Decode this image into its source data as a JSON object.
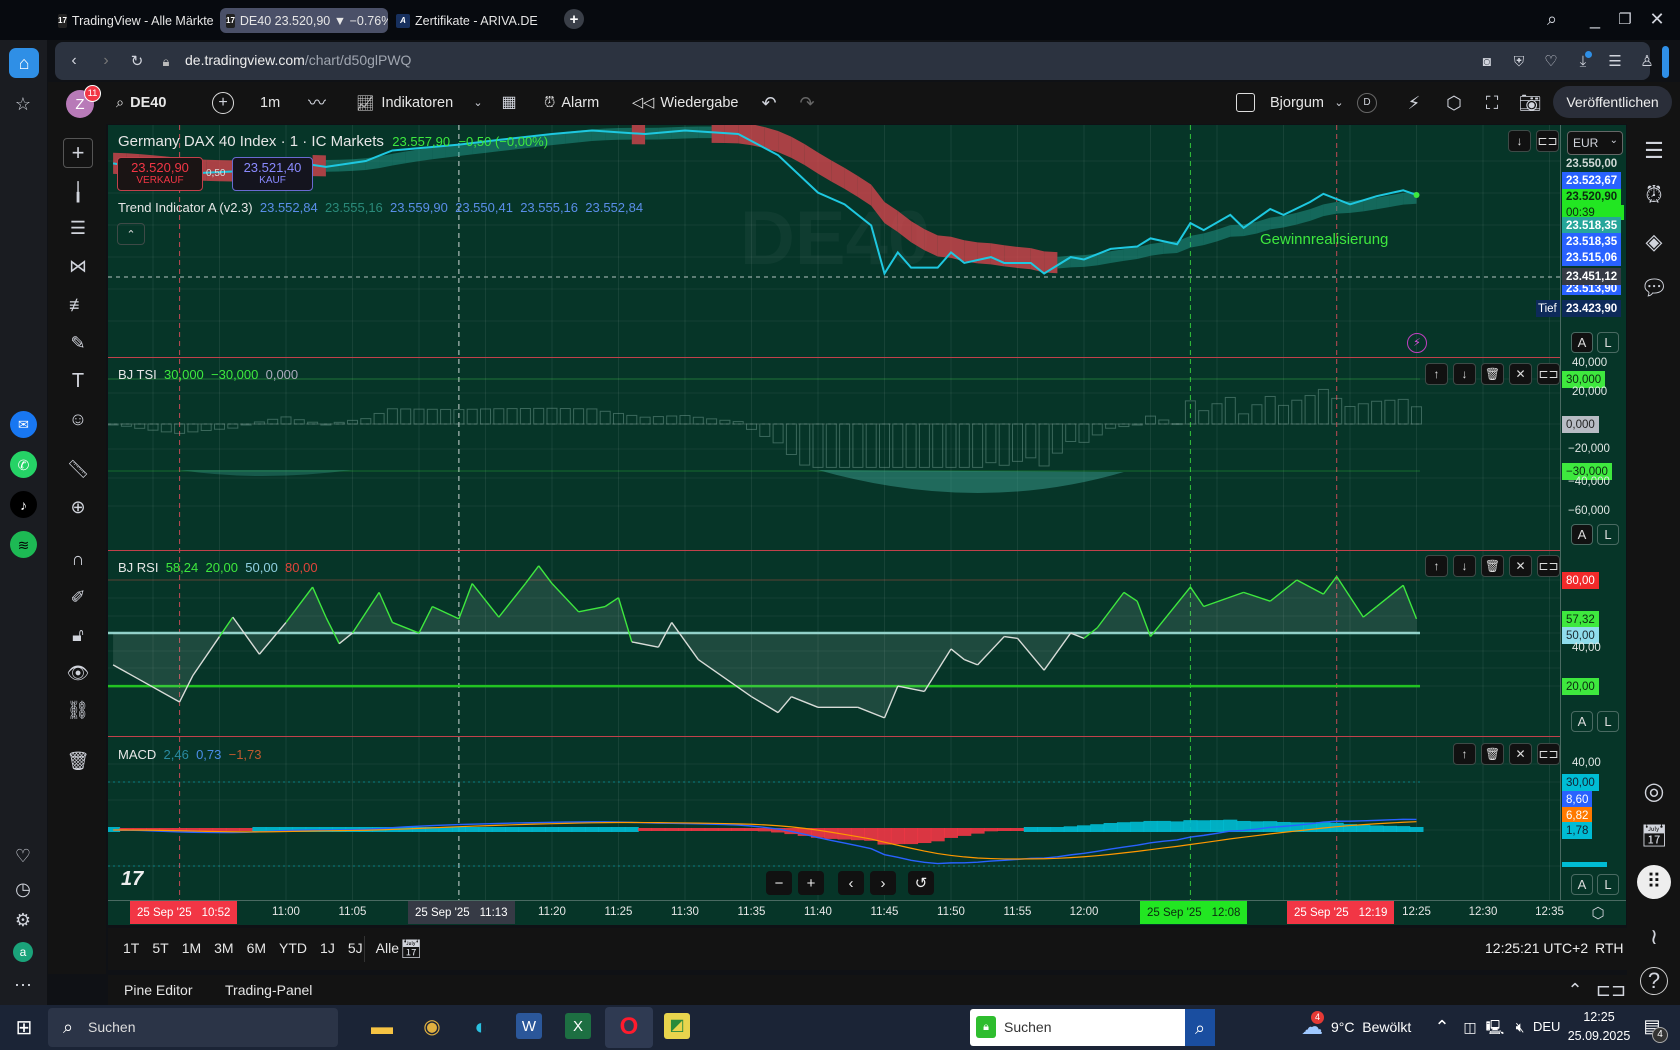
{
  "browser": {
    "tabs": [
      {
        "label": "TradingView - Alle Märkte"
      },
      {
        "label": "DE40 23.520,90 ▼ −0.76%"
      },
      {
        "label": "Zertifikate - ARIVA.DE"
      }
    ],
    "new_tab": "+",
    "url_domain": "de.tradingview.com",
    "url_path": "/chart/d50glPWQ"
  },
  "toolbar": {
    "avatar": "Z",
    "avatar_badge": "11",
    "symbol": "DE40",
    "interval": "1m",
    "indicators": "Indikatoren",
    "alarm": "Alarm",
    "replay": "Wiedergabe",
    "layout": "Bjorgum",
    "d_badge": "D",
    "publish": "Veröffentlichen"
  },
  "main": {
    "title": "Germany DAX 40 Index · 1 · IC Markets",
    "last": "23.557,90",
    "change": "−0,50 (−0,00%)",
    "sell_price": "23.520,90",
    "sell_label": "VERKAUF",
    "spread": "0,50",
    "buy_price": "23.521,40",
    "buy_label": "KAUF",
    "indicator_name": "Trend Indicator A (v2.3)",
    "indicator_values": [
      "23.552,84",
      "23.555,16",
      "23.559,90",
      "23.550,41",
      "23.555,16",
      "23.552,84"
    ],
    "watermark": "DE40",
    "annotation": "Gewinnrealisierung",
    "currency": "EUR",
    "price_labels": [
      {
        "text": "23.550,00",
        "bg": "#063528",
        "fg": "#e0e6e4"
      },
      {
        "text": "23.523,67",
        "bg": "#2962ff",
        "fg": "#ffffff"
      },
      {
        "text": "23.520,90",
        "bg": "#22e622",
        "fg": "#0b2a10"
      },
      {
        "text": "00:39",
        "bg": "#22e622",
        "fg": "#0b2a10"
      },
      {
        "text": "23.518,35",
        "bg": "#26a69a",
        "fg": "#ffffff"
      },
      {
        "text": "23.518,35",
        "bg": "#2962ff",
        "fg": "#ffffff"
      },
      {
        "text": "23.515,06",
        "bg": "#2962ff",
        "fg": "#ffffff"
      },
      {
        "text": "23.451,12",
        "bg": "#363a45",
        "fg": "#ffffff"
      },
      {
        "text": "23.513,90",
        "bg": "#2962ff",
        "fg": "#ffffff"
      }
    ],
    "low_label": "Tief",
    "low_value": "23.423,90"
  },
  "scale_buttons": {
    "auto": "A",
    "log": "L"
  },
  "tsi": {
    "name": "BJ TSI",
    "values": [
      "30,000",
      "−30,000",
      "0,000"
    ],
    "axis": [
      "40,000",
      "30,000",
      "20,000",
      "0,000",
      "−20,000",
      "−30,000",
      "−40,000",
      "−60,000"
    ]
  },
  "rsi": {
    "name": "BJ RSI",
    "values": [
      "58,24",
      "20,00",
      "50,00",
      "80,00"
    ],
    "axis": [
      "80,00",
      "57,32",
      "50,00",
      "40,00",
      "20,00"
    ]
  },
  "macd": {
    "name": "MACD",
    "values": [
      "2,46",
      "0,73",
      "−1,73"
    ],
    "axis": [
      "40,00",
      "30,00",
      "8,60",
      "6,82",
      "1,78"
    ]
  },
  "time_axis": {
    "labels": [
      "11:00",
      "11:05",
      "11:20",
      "11:25",
      "11:30",
      "11:35",
      "11:40",
      "11:45",
      "11:50",
      "11:55",
      "12:00",
      "12:25",
      "12:30",
      "12:35"
    ],
    "markers": [
      {
        "date": "25 Sep '25",
        "time": "10:52",
        "bg": "#f23645"
      },
      {
        "date": "25 Sep '25",
        "time": "11:13",
        "bg": "#363a45"
      },
      {
        "date": "25 Sep '25",
        "time": "12:08",
        "bg": "#22e622"
      },
      {
        "date": "25 Sep '25",
        "time": "12:19",
        "bg": "#f23645"
      }
    ]
  },
  "range_bar": {
    "items": [
      "1T",
      "5T",
      "1M",
      "3M",
      "6M",
      "YTD",
      "1J",
      "5J",
      "Alle"
    ],
    "clock": "12:25:21 UTC+2",
    "session": "RTH"
  },
  "bottom_panel": {
    "tabs": [
      "Pine Editor",
      "Trading-Panel"
    ]
  },
  "taskbar": {
    "search": "Suchen",
    "search2": "Suchen",
    "weather_badge": "4",
    "temp": "9°C",
    "weather": "Bewölkt",
    "lang": "DEU",
    "time": "12:25",
    "date": "25.09.2025",
    "notifications": "4"
  },
  "colors": {
    "chart_bg": "#063528",
    "price_line": "#1ec8e0",
    "trend_up": "#26a69a",
    "trend_down": "#e0454f",
    "rsi_up": "#3ee83e",
    "rsi_down": "#d8dcd8",
    "macd": "#2962ff",
    "signal": "#ff9800",
    "hist_pos": "#00bcd4",
    "hist_neg": "#f23645"
  },
  "chart_series": {
    "price": [
      [
        "10:47",
        23548
      ],
      [
        "10:52",
        23539
      ],
      [
        "10:56",
        23541
      ],
      [
        "11:00",
        23550
      ],
      [
        "11:03",
        23545
      ],
      [
        "11:06",
        23550
      ],
      [
        "11:08",
        23559
      ],
      [
        "11:13",
        23564
      ],
      [
        "11:16",
        23568
      ],
      [
        "11:20",
        23573
      ],
      [
        "11:23",
        23576
      ],
      [
        "11:27",
        23573
      ],
      [
        "11:30",
        23576
      ],
      [
        "11:34",
        23573
      ],
      [
        "11:37",
        23555
      ],
      [
        "11:40",
        23523
      ],
      [
        "11:42",
        23513
      ],
      [
        "11:44",
        23495
      ],
      [
        "11:45",
        23454
      ],
      [
        "11:46",
        23472
      ],
      [
        "11:47",
        23459
      ],
      [
        "11:49",
        23459
      ],
      [
        "11:50",
        23472
      ],
      [
        "11:51",
        23463
      ],
      [
        "11:53",
        23468
      ],
      [
        "11:54",
        23463
      ],
      [
        "11:56",
        23463
      ],
      [
        "11:57",
        23454
      ],
      [
        "11:59",
        23468
      ],
      [
        "12:00",
        23466
      ],
      [
        "12:02",
        23475
      ],
      [
        "12:04",
        23477
      ],
      [
        "12:05",
        23484
      ],
      [
        "12:07",
        23479
      ],
      [
        "12:08",
        23497
      ],
      [
        "12:09",
        23491
      ],
      [
        "12:11",
        23504
      ],
      [
        "12:12",
        23493
      ],
      [
        "12:14",
        23509
      ],
      [
        "12:15",
        23504
      ],
      [
        "12:17",
        23515
      ],
      [
        "12:18",
        23522
      ],
      [
        "12:20",
        23513
      ],
      [
        "12:22",
        23520
      ],
      [
        "12:24",
        23525
      ],
      [
        "12:25",
        23521
      ]
    ],
    "rsi": [
      [
        "10:47",
        32
      ],
      [
        "10:52",
        11
      ],
      [
        "10:53",
        26
      ],
      [
        "10:55",
        48
      ],
      [
        "10:56",
        59
      ],
      [
        "10:58",
        38
      ],
      [
        "11:00",
        56
      ],
      [
        "11:02",
        76
      ],
      [
        "11:03",
        59
      ],
      [
        "11:04",
        44
      ],
      [
        "11:05",
        50
      ],
      [
        "11:07",
        73
      ],
      [
        "11:08",
        56
      ],
      [
        "11:10",
        50
      ],
      [
        "11:11",
        65
      ],
      [
        "11:13",
        58
      ],
      [
        "11:14",
        78
      ],
      [
        "11:16",
        59
      ],
      [
        "11:18",
        78
      ],
      [
        "11:19",
        88
      ],
      [
        "11:20",
        78
      ],
      [
        "11:22",
        62
      ],
      [
        "11:24",
        65
      ],
      [
        "11:25",
        70
      ],
      [
        "11:26",
        45
      ],
      [
        "11:28",
        42
      ],
      [
        "11:29",
        56
      ],
      [
        "11:31",
        35
      ],
      [
        "11:35",
        14
      ],
      [
        "11:37",
        5
      ],
      [
        "11:38",
        14
      ],
      [
        "11:40",
        8
      ],
      [
        "11:43",
        8
      ],
      [
        "11:45",
        2
      ],
      [
        "11:46",
        20
      ],
      [
        "11:48",
        17
      ],
      [
        "11:50",
        41
      ],
      [
        "11:51",
        35
      ],
      [
        "11:52",
        32
      ],
      [
        "11:54",
        48
      ],
      [
        "11:55",
        47
      ],
      [
        "11:57",
        29
      ],
      [
        "11:59",
        50
      ],
      [
        "12:00",
        47
      ],
      [
        "12:01",
        53
      ],
      [
        "12:03",
        73
      ],
      [
        "12:04",
        68
      ],
      [
        "12:05",
        48
      ],
      [
        "12:08",
        76
      ],
      [
        "12:09",
        65
      ],
      [
        "12:12",
        73
      ],
      [
        "12:14",
        68
      ],
      [
        "12:16",
        80
      ],
      [
        "12:18",
        72
      ],
      [
        "12:19",
        82
      ],
      [
        "12:21",
        59
      ],
      [
        "12:22",
        65
      ],
      [
        "12:24",
        77
      ],
      [
        "12:25",
        58
      ]
    ]
  }
}
